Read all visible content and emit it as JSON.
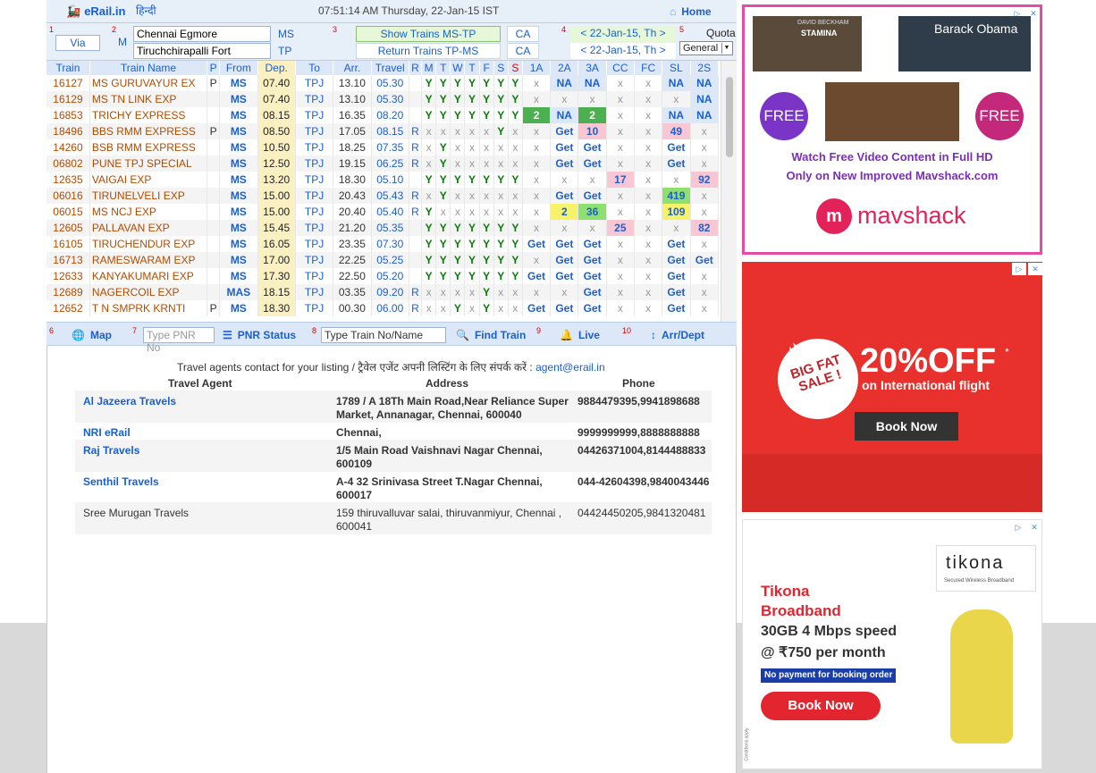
{
  "header": {
    "logo": "eRail.in",
    "hindi_link": "हिन्दी",
    "clock": "07:51:14 AM Thursday, 22-Jan-15 IST",
    "home": "Home"
  },
  "form": {
    "nums": [
      "1",
      "2",
      "3",
      "4",
      "5"
    ],
    "via": "Via",
    "m": "M",
    "from_station": "Chennai Egmore",
    "to_station": "Tiruchchirapalli Fort",
    "from_code": "MS",
    "to_code": "TP",
    "show_trains": "Show Trains  MS-TP",
    "return_trains": "Return Trains  TP-MS",
    "ca1": "CA",
    "ca2": "CA",
    "date1": "< 22-Jan-15, Th >",
    "date2": "< 22-Jan-15, Th >",
    "quota_label": "Quota",
    "quota_value": "General"
  },
  "table": {
    "headers": [
      "Train",
      "Train Name",
      "P",
      "From",
      "Dep.",
      "To",
      "Arr.",
      "Travel",
      "R",
      "M",
      "T",
      "W",
      "T",
      "F",
      "S",
      "S",
      "1A",
      "2A",
      "3A",
      "CC",
      "FC",
      "SL",
      "2S"
    ],
    "rows": [
      {
        "no": "16127",
        "name": "MS GURUVAYUR EX",
        "p": "P",
        "from": "MS",
        "dep": "07.40",
        "to": "TPJ",
        "arr": "13.10",
        "travel": "05.30",
        "r": "",
        "days": [
          "Y",
          "Y",
          "Y",
          "Y",
          "Y",
          "Y",
          "Y"
        ],
        "cls": [
          "x",
          "NA",
          "NA",
          "x",
          "x",
          "NA",
          "NA"
        ]
      },
      {
        "no": "16129",
        "name": "MS TN LINK EXP",
        "p": "",
        "from": "MS",
        "dep": "07.40",
        "to": "TPJ",
        "arr": "13.10",
        "travel": "05.30",
        "r": "",
        "days": [
          "Y",
          "Y",
          "Y",
          "Y",
          "Y",
          "Y",
          "Y"
        ],
        "cls": [
          "x",
          "x",
          "x",
          "x",
          "x",
          "x",
          "NA"
        ]
      },
      {
        "no": "16853",
        "name": "TRICHY EXPRESS",
        "p": "",
        "from": "MS",
        "dep": "08.15",
        "to": "TPJ",
        "arr": "16.35",
        "travel": "08.20",
        "r": "",
        "days": [
          "Y",
          "Y",
          "Y",
          "Y",
          "Y",
          "Y",
          "Y"
        ],
        "cls": [
          "2",
          "NA",
          "2",
          "x",
          "x",
          "NA",
          "NA"
        ]
      },
      {
        "no": "18496",
        "name": "BBS RMM EXPRESS",
        "p": "P",
        "from": "MS",
        "dep": "08.50",
        "to": "TPJ",
        "arr": "17.05",
        "travel": "08.15",
        "r": "R",
        "days": [
          "x",
          "x",
          "x",
          "x",
          "x",
          "Y",
          "x"
        ],
        "cls": [
          "x",
          "Get",
          "10",
          "x",
          "x",
          "49",
          "x"
        ]
      },
      {
        "no": "14260",
        "name": "BSB RMM EXPRESS",
        "p": "",
        "from": "MS",
        "dep": "10.50",
        "to": "TPJ",
        "arr": "18.25",
        "travel": "07.35",
        "r": "R",
        "days": [
          "x",
          "Y",
          "x",
          "x",
          "x",
          "x",
          "x"
        ],
        "cls": [
          "x",
          "Get",
          "Get",
          "x",
          "x",
          "Get",
          "x"
        ]
      },
      {
        "no": "06802",
        "name": "PUNE TPJ SPECIAL",
        "p": "",
        "from": "MS",
        "dep": "12.50",
        "to": "TPJ",
        "arr": "19.15",
        "travel": "06.25",
        "r": "R",
        "days": [
          "x",
          "Y",
          "x",
          "x",
          "x",
          "x",
          "x"
        ],
        "cls": [
          "x",
          "Get",
          "Get",
          "x",
          "x",
          "Get",
          "x"
        ]
      },
      {
        "no": "12635",
        "name": "VAIGAI EXP",
        "p": "",
        "from": "MS",
        "dep": "13.20",
        "to": "TPJ",
        "arr": "18.30",
        "travel": "05.10",
        "r": "",
        "days": [
          "Y",
          "Y",
          "Y",
          "Y",
          "Y",
          "Y",
          "Y"
        ],
        "cls": [
          "x",
          "x",
          "x",
          "17",
          "x",
          "x",
          "92"
        ]
      },
      {
        "no": "06016",
        "name": "TIRUNELVELI EXP",
        "p": "",
        "from": "MS",
        "dep": "15.00",
        "to": "TPJ",
        "arr": "20.43",
        "travel": "05.43",
        "r": "R",
        "days": [
          "x",
          "Y",
          "x",
          "x",
          "x",
          "x",
          "x"
        ],
        "cls": [
          "x",
          "Get",
          "Get",
          "x",
          "x",
          "419",
          "x"
        ]
      },
      {
        "no": "06015",
        "name": "MS NCJ EXP",
        "p": "",
        "from": "MS",
        "dep": "15.00",
        "to": "TPJ",
        "arr": "20.40",
        "travel": "05.40",
        "r": "R",
        "days": [
          "Y",
          "x",
          "x",
          "x",
          "x",
          "x",
          "x"
        ],
        "cls": [
          "x",
          "2",
          "36",
          "x",
          "x",
          "109",
          "x"
        ]
      },
      {
        "no": "12605",
        "name": "PALLAVAN EXP",
        "p": "",
        "from": "MS",
        "dep": "15.45",
        "to": "TPJ",
        "arr": "21.20",
        "travel": "05.35",
        "r": "",
        "days": [
          "Y",
          "Y",
          "Y",
          "Y",
          "Y",
          "Y",
          "Y"
        ],
        "cls": [
          "x",
          "x",
          "x",
          "25",
          "x",
          "x",
          "82"
        ]
      },
      {
        "no": "16105",
        "name": "TIRUCHENDUR EXP",
        "p": "",
        "from": "MS",
        "dep": "16.05",
        "to": "TPJ",
        "arr": "23.35",
        "travel": "07.30",
        "r": "",
        "days": [
          "Y",
          "Y",
          "Y",
          "Y",
          "Y",
          "Y",
          "Y"
        ],
        "cls": [
          "Get",
          "Get",
          "Get",
          "x",
          "x",
          "Get",
          "x"
        ]
      },
      {
        "no": "16713",
        "name": "RAMESWARAM EXP",
        "p": "",
        "from": "MS",
        "dep": "17.00",
        "to": "TPJ",
        "arr": "22.25",
        "travel": "05.25",
        "r": "",
        "days": [
          "Y",
          "Y",
          "Y",
          "Y",
          "Y",
          "Y",
          "Y"
        ],
        "cls": [
          "x",
          "Get",
          "Get",
          "x",
          "x",
          "Get",
          "Get"
        ]
      },
      {
        "no": "12633",
        "name": "KANYAKUMARI EXP",
        "p": "",
        "from": "MS",
        "dep": "17.30",
        "to": "TPJ",
        "arr": "22.50",
        "travel": "05.20",
        "r": "",
        "days": [
          "Y",
          "Y",
          "Y",
          "Y",
          "Y",
          "Y",
          "Y"
        ],
        "cls": [
          "Get",
          "Get",
          "Get",
          "x",
          "x",
          "Get",
          "x"
        ]
      },
      {
        "no": "12689",
        "name": "NAGERCOIL EXP",
        "p": "",
        "from": "MAS",
        "dep": "18.15",
        "to": "TPJ",
        "arr": "03.35",
        "travel": "09.20",
        "r": "R",
        "days": [
          "x",
          "x",
          "x",
          "x",
          "Y",
          "x",
          "x"
        ],
        "cls": [
          "x",
          "x",
          "Get",
          "x",
          "x",
          "Get",
          "x"
        ]
      },
      {
        "no": "12652",
        "name": "T N SMPRK KRNTI",
        "p": "P",
        "from": "MS",
        "dep": "18.30",
        "to": "TPJ",
        "arr": "00.30",
        "travel": "06.00",
        "r": "R",
        "days": [
          "x",
          "x",
          "Y",
          "x",
          "Y",
          "x",
          "x"
        ],
        "cls": [
          "Get",
          "Get",
          "Get",
          "x",
          "x",
          "Get",
          "x"
        ]
      }
    ]
  },
  "toolbar": {
    "nums": [
      "6",
      "7",
      "8",
      "9",
      "10"
    ],
    "map": "Map",
    "pnr_placeholder": "Type PNR No",
    "pnr_status": "PNR Status",
    "train_placeholder": "Type Train No/Name",
    "find_train": "Find Train",
    "live": "Live",
    "arrdept": "Arr/Dept"
  },
  "agents": {
    "note": "Travel agents contact for your listing / ट्रैवेल एजेंट अपनी लिस्टिंग के लिए संपर्क करें :",
    "email": "agent@erail.in",
    "col_agent": "Travel Agent",
    "col_address": "Address",
    "col_phone": "Phone",
    "rows": [
      {
        "name": "Al Jazeera Travels",
        "address": "1789 / A 18Th Main Road,Near Reliance Super Market, Annanagar, Chennai, 600040",
        "phone": "9884479395,9941898688"
      },
      {
        "name": "NRI eRail",
        "address": "Chennai,",
        "phone": "9999999999,8888888888"
      },
      {
        "name": "Raj Travels",
        "address": "1/5 Main Road Vaishnavi Nagar Chennai, 600109",
        "phone": "04426371004,8144488833"
      },
      {
        "name": "Senthil Travels",
        "address": "A-4 32 Srinivasa Street T.Nagar Chennai, 600017",
        "phone": "044-42604398,9840043446"
      },
      {
        "name": "Sree Murugan Travels",
        "address": "159 thiruvalluvar salai, thiruvanmiyur, Chennai , 600041",
        "phone": "04424450205,9841320481"
      }
    ]
  },
  "ads": {
    "ad1": {
      "poster_left_text": "DAVID BECKHAM",
      "poster_left_sub": "STAMINA",
      "poster_right_text": "Barack Obama",
      "free1": "FREE",
      "free2": "FREE",
      "line1": "Watch Free Video Content  in Full HD",
      "line2": "Only on New Improved Mavshack.com",
      "brand": "mavshack"
    },
    "ad2": {
      "badge": "BIG FAT SALE !",
      "offer": "20%OFF",
      "star": "*",
      "subline": "on International flight",
      "cta": "Book Now"
    },
    "ad3": {
      "brand": "tikona",
      "brand_sub": "Secured Wireless Broadband",
      "title1": "Tikona",
      "title2": "Broadband",
      "speed1": "30GB 4 Mbps speed",
      "speed2": "@ ₹750 per month",
      "no_payment": "No payment for booking order",
      "cta": "Book Now",
      "conditions": "Conditions apply"
    },
    "chip_i": "▷",
    "chip_x": "✕"
  },
  "colors": {
    "link": "#1a5fd0",
    "train_name": "#b24b00",
    "dep_bg": "#fbf0c2",
    "header_bg": "#dce8f7",
    "yes_green": "#0a7a0a"
  }
}
